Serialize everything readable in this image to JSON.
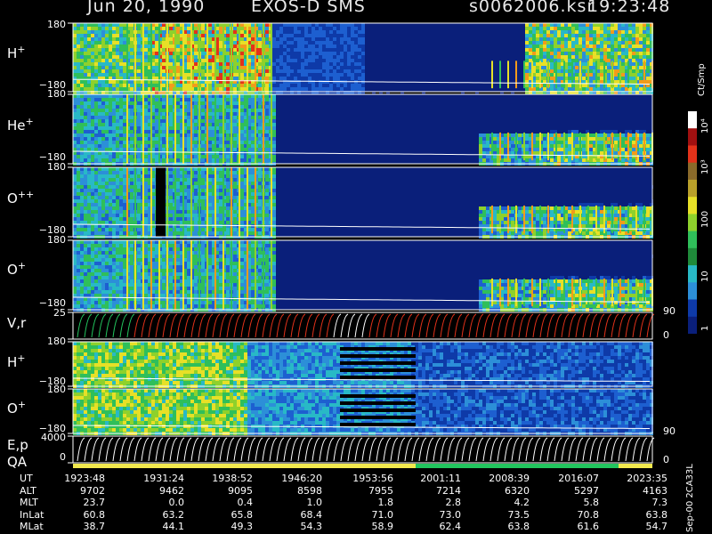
{
  "header": {
    "date": "Jun 20, 1990",
    "instrument": "EXOS-D SMS",
    "file": "s0062006.ksr",
    "time": "19:23:48"
  },
  "chart_data": {
    "type": "heatmap",
    "panels": [
      {
        "label_main": "H",
        "label_sup": "+",
        "ytop": "180",
        "ybot": "−180"
      },
      {
        "label_main": "He",
        "label_sup": "+",
        "ytop": "180",
        "ybot": "−180"
      },
      {
        "label_main": "O",
        "label_sup": "++",
        "ytop": "180",
        "ybot": "−180"
      },
      {
        "label_main": "O",
        "label_sup": "+",
        "ytop": "180",
        "ybot": "−180"
      },
      {
        "label_main": "V,r",
        "label_sup": "",
        "ytop": "25",
        "ybot": ""
      },
      {
        "label_main": "H",
        "label_sup": "+",
        "ytop": "180",
        "ybot": "−180"
      },
      {
        "label_main": "O",
        "label_sup": "+",
        "ytop": "180",
        "ybot": "−180"
      },
      {
        "label_main": "E,p",
        "label_sup": "",
        "ytop": "4000",
        "ybot": "0"
      }
    ],
    "qa_label": "QA",
    "right_ticks": [
      {
        "text": "90"
      },
      {
        "text": "0"
      },
      {
        "text": "90"
      },
      {
        "text": "0"
      }
    ],
    "colorbar": {
      "unit": "Ct/Smp",
      "labels": [
        "1",
        "10",
        "100",
        "10³",
        "10⁴"
      ]
    },
    "axis_table": {
      "rows": [
        {
          "name": "UT",
          "values": [
            "1923:48",
            "1931:24",
            "1938:52",
            "1946:20",
            "1953:56",
            "2001:11",
            "2008:39",
            "2016:07",
            "2023:35"
          ]
        },
        {
          "name": "ALT",
          "values": [
            "9702",
            "9462",
            "9095",
            "8598",
            "7955",
            "7214",
            "6320",
            "5297",
            "4163"
          ]
        },
        {
          "name": "MLT",
          "values": [
            "23.7",
            "0.0",
            "0.4",
            "1.0",
            "1.8",
            "2.8",
            "4.2",
            "5.8",
            "7.3"
          ]
        },
        {
          "name": "InLat",
          "values": [
            "60.8",
            "63.2",
            "65.8",
            "68.4",
            "71.0",
            "73.0",
            "73.5",
            "70.8",
            "63.8"
          ]
        },
        {
          "name": "MLat",
          "values": [
            "38.7",
            "44.1",
            "49.3",
            "54.3",
            "58.9",
            "62.4",
            "63.8",
            "61.6",
            "54.7"
          ]
        }
      ]
    },
    "footer": "Sep-00 2CA33L",
    "colors": {
      "background_low": "#0a1f7a",
      "qa_good": "#f2e94e",
      "qa_ok": "#22c55e"
    }
  }
}
